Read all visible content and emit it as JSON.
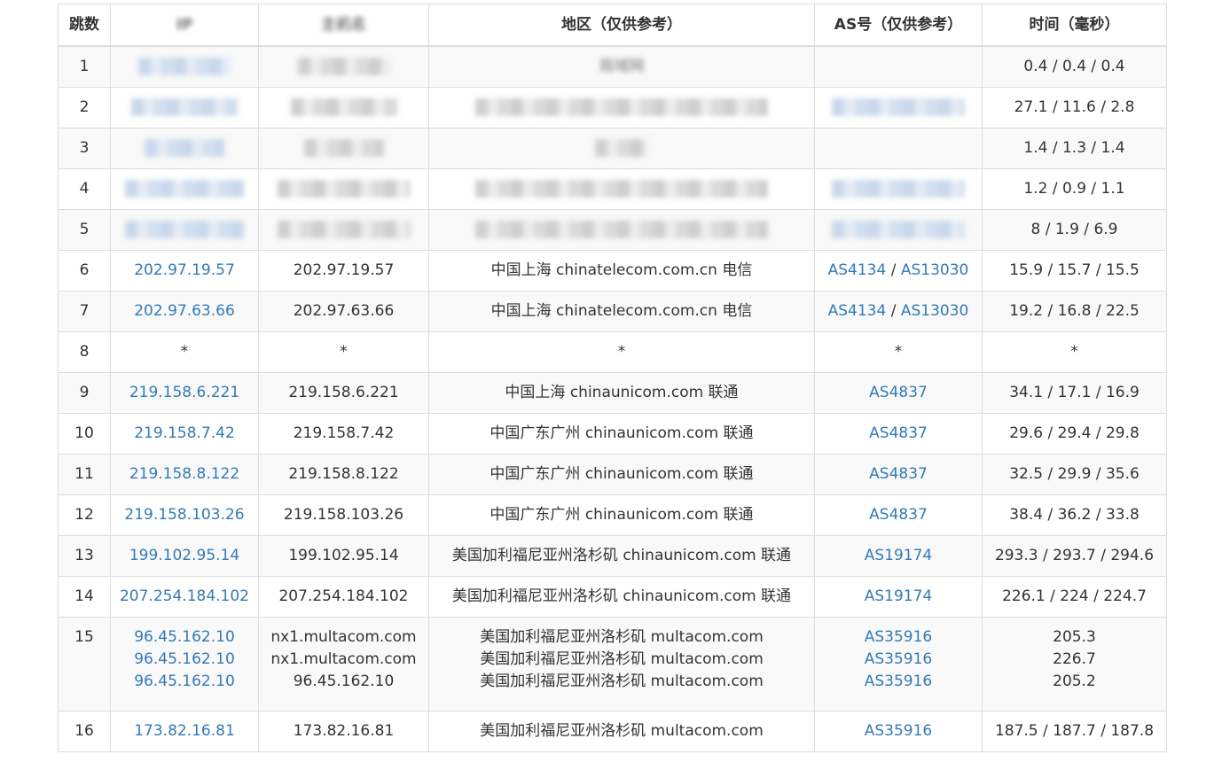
{
  "headers": {
    "hop": "跳数",
    "ip": "IP",
    "host": "主机名",
    "region": "地区（仅供参考）",
    "as": "AS号（仅供参考）",
    "time": "时间（毫秒）"
  },
  "redacted_rows": [
    {
      "hop": "1",
      "region_text": "局域网",
      "time": "0.4 / 0.4 / 0.4"
    },
    {
      "hop": "2",
      "time": "27.1 / 11.6 / 2.8"
    },
    {
      "hop": "3",
      "time": "1.4 / 1.3 / 1.4"
    },
    {
      "hop": "4",
      "time": "1.2 / 0.9 / 1.1"
    },
    {
      "hop": "5",
      "time": "8 / 1.9 / 6.9"
    }
  ],
  "rows": {
    "r6": {
      "hop": "6",
      "ip": "202.97.19.57",
      "host": "202.97.19.57",
      "region": "中国上海 chinatelecom.com.cn 电信",
      "as1": "AS4134",
      "sep": " / ",
      "as2": "AS13030",
      "time": "15.9 / 15.7 / 15.5"
    },
    "r7": {
      "hop": "7",
      "ip": "202.97.63.66",
      "host": "202.97.63.66",
      "region": "中国上海 chinatelecom.com.cn 电信",
      "as1": "AS4134",
      "sep": " / ",
      "as2": "AS13030",
      "time": "19.2 / 16.8 / 22.5"
    },
    "r8": {
      "hop": "8",
      "ip": "*",
      "host": "*",
      "region": "*",
      "as": "*",
      "time": "*"
    },
    "r9": {
      "hop": "9",
      "ip": "219.158.6.221",
      "host": "219.158.6.221",
      "region": "中国上海 chinaunicom.com 联通",
      "as": "AS4837",
      "time": "34.1 / 17.1 / 16.9"
    },
    "r10": {
      "hop": "10",
      "ip": "219.158.7.42",
      "host": "219.158.7.42",
      "region": "中国广东广州 chinaunicom.com 联通",
      "as": "AS4837",
      "time": "29.6 / 29.4 / 29.8"
    },
    "r11": {
      "hop": "11",
      "ip": "219.158.8.122",
      "host": "219.158.8.122",
      "region": "中国广东广州 chinaunicom.com 联通",
      "as": "AS4837",
      "time": "32.5 / 29.9 / 35.6"
    },
    "r12": {
      "hop": "12",
      "ip": "219.158.103.26",
      "host": "219.158.103.26",
      "region": "中国广东广州 chinaunicom.com 联通",
      "as": "AS4837",
      "time": "38.4 / 36.2 / 33.8"
    },
    "r13": {
      "hop": "13",
      "ip": "199.102.95.14",
      "host": "199.102.95.14",
      "region": "美国加利福尼亚州洛杉矶 chinaunicom.com 联通",
      "as": "AS19174",
      "time": "293.3 / 293.7 / 294.6"
    },
    "r14": {
      "hop": "14",
      "ip": "207.254.184.102",
      "host": "207.254.184.102",
      "region": "美国加利福尼亚州洛杉矶 chinaunicom.com 联通",
      "as": "AS19174",
      "time": "226.1 / 224 / 224.7"
    },
    "r15": {
      "hop": "15",
      "ip": [
        "96.45.162.10",
        "96.45.162.10",
        "96.45.162.10"
      ],
      "host": [
        "nx1.multacom.com",
        "nx1.multacom.com",
        "96.45.162.10"
      ],
      "region": [
        "美国加利福尼亚州洛杉矶 multacom.com",
        "美国加利福尼亚州洛杉矶 multacom.com",
        "美国加利福尼亚州洛杉矶 multacom.com"
      ],
      "as": [
        "AS35916",
        "AS35916",
        "AS35916"
      ],
      "time": [
        "205.3",
        "226.7",
        "205.2"
      ]
    },
    "r16": {
      "hop": "16",
      "ip": "173.82.16.81",
      "host": "173.82.16.81",
      "region": "美国加利福尼亚州洛杉矶 multacom.com",
      "as": "AS35916",
      "time": "187.5 / 187.7 / 187.8"
    }
  }
}
